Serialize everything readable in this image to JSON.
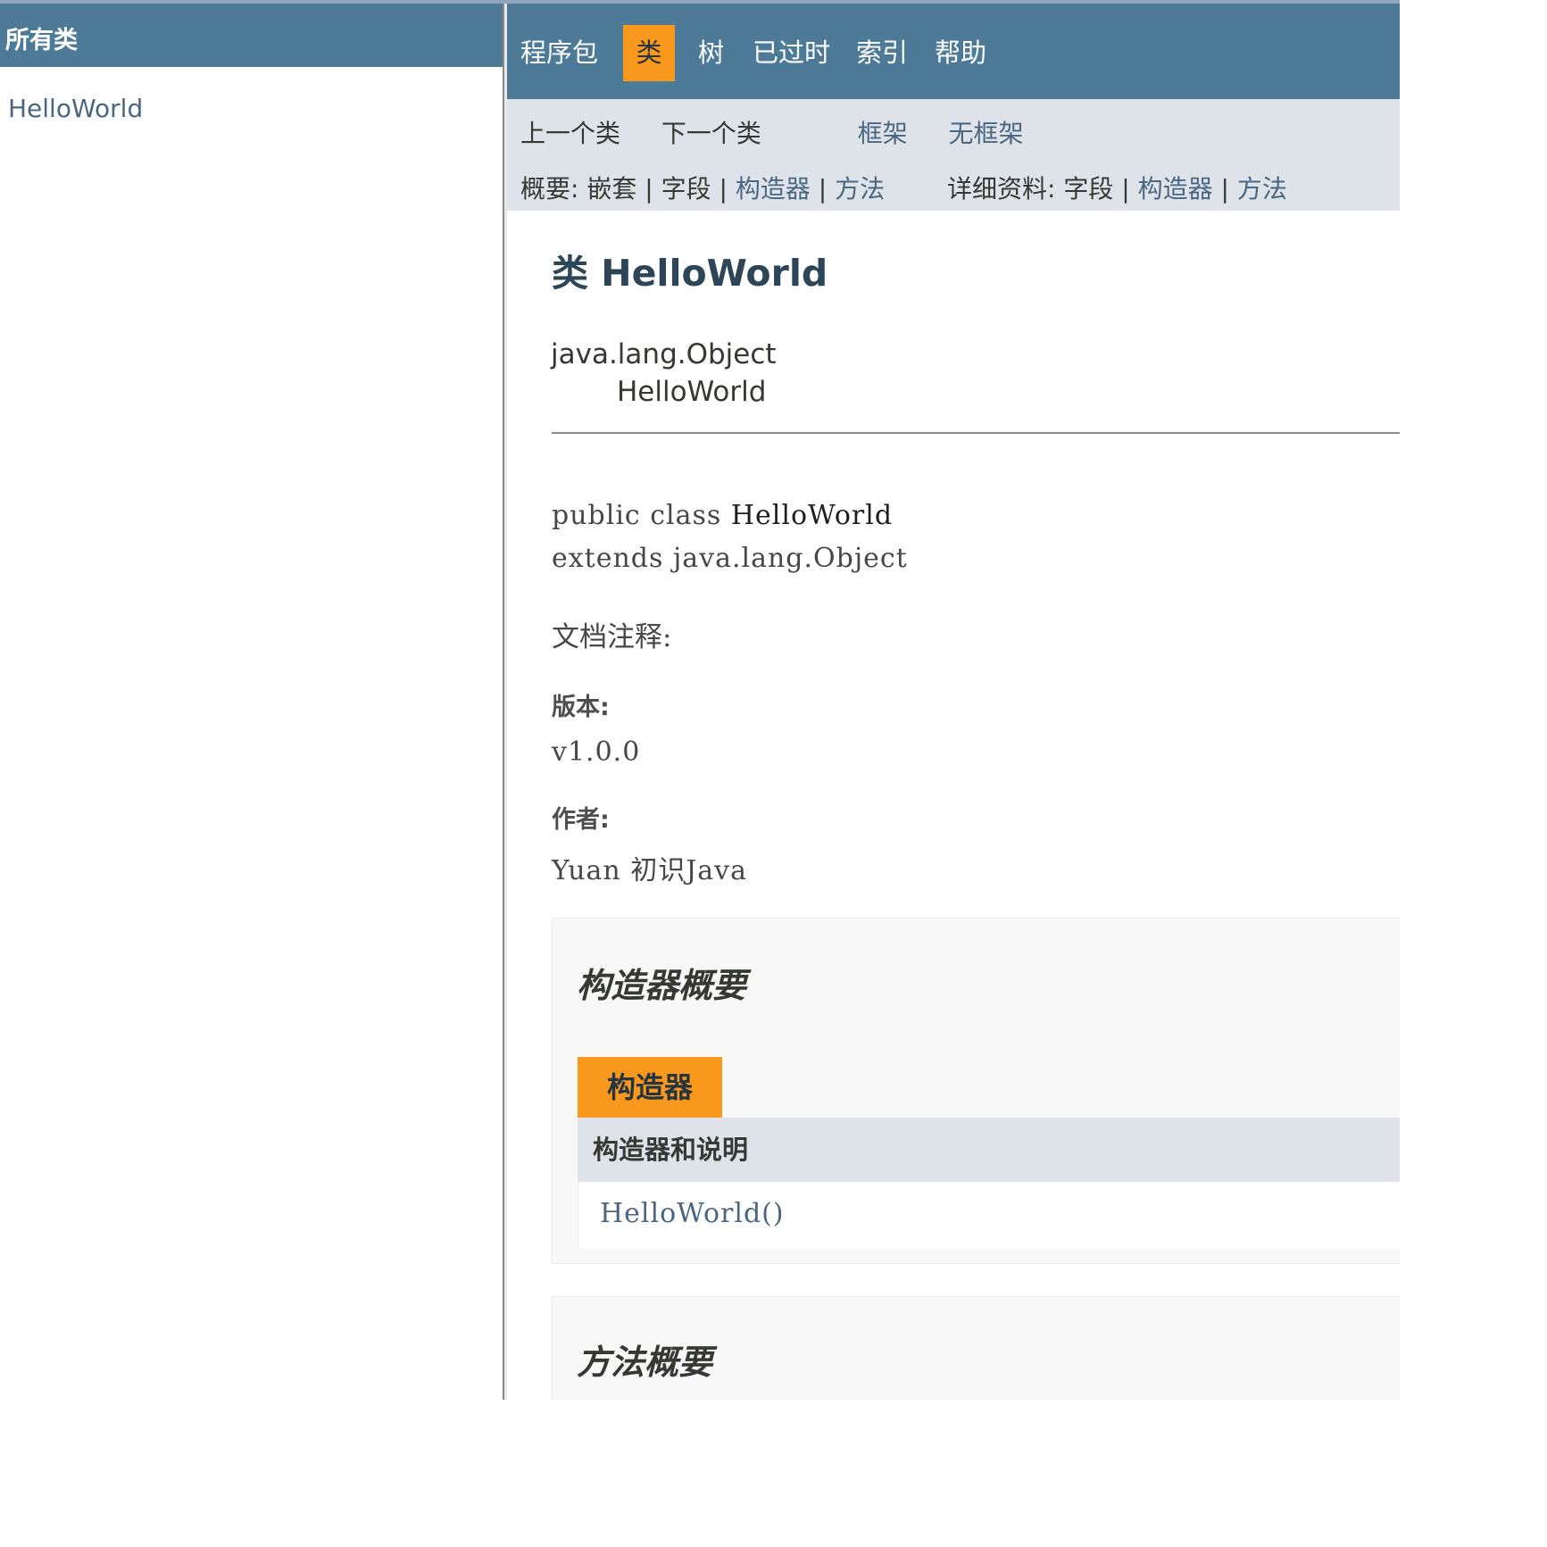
{
  "left": {
    "title": "所有类",
    "classes": [
      "HelloWorld"
    ]
  },
  "nav": {
    "items": [
      "程序包",
      "类",
      "树",
      "已过时",
      "索引",
      "帮助"
    ],
    "active": "类"
  },
  "subnav": {
    "prev_class": "上一个类",
    "next_class": "下一个类",
    "frames": "框架",
    "no_frames": "无框架",
    "summary_label": "概要:",
    "summary_nested": "嵌套",
    "summary_field": "字段",
    "summary_constructor": "构造器",
    "summary_method": "方法",
    "detail_label": "详细资料:",
    "detail_field": "字段",
    "detail_constructor": "构造器",
    "detail_method": "方法",
    "separator": "|"
  },
  "class_info": {
    "title": "类 HelloWorld",
    "inheritance": [
      "java.lang.Object",
      "HelloWorld"
    ],
    "decl_prefix": "public class ",
    "decl_name": "HelloWorld",
    "decl_extends": "extends java.lang.Object",
    "doc_comment": "文档注释:",
    "version_label": "版本:",
    "version_value": "v1.0.0",
    "author_label": "作者:",
    "author_value": "Yuan 初识Java"
  },
  "constructor_summary": {
    "heading": "构造器概要",
    "caption": "构造器",
    "column_header": "构造器和说明",
    "rows": [
      "HelloWorld()"
    ]
  },
  "method_summary": {
    "heading": "方法概要"
  },
  "colors": {
    "nav_bg": "#4d7a97",
    "active_tab": "#f8981d",
    "subnav_bg": "#dee3e9",
    "link": "#4a6782"
  }
}
